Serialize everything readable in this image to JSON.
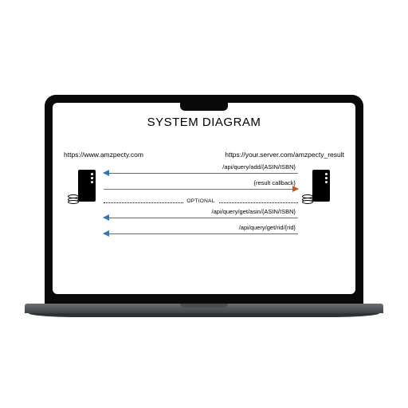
{
  "title": "SYSTEM DIAGRAM",
  "left_url": "https://www.amzpecty.com",
  "right_url": "https://your.server.com/amzpecty_result",
  "arrows": [
    {
      "label": "/api/query/add/{ASIN/ISBN}",
      "dir": "left",
      "color": "blue"
    },
    {
      "label": "{result callback}",
      "dir": "right",
      "color": "orange"
    }
  ],
  "optional_label": "OPTIONAL",
  "optional_arrows": [
    {
      "label": "/api/query/get/asin/{ASIN/ISBN}",
      "dir": "left",
      "color": "blue"
    },
    {
      "label": "/api/query/get/rid/{rid}",
      "dir": "left",
      "color": "blue"
    }
  ]
}
